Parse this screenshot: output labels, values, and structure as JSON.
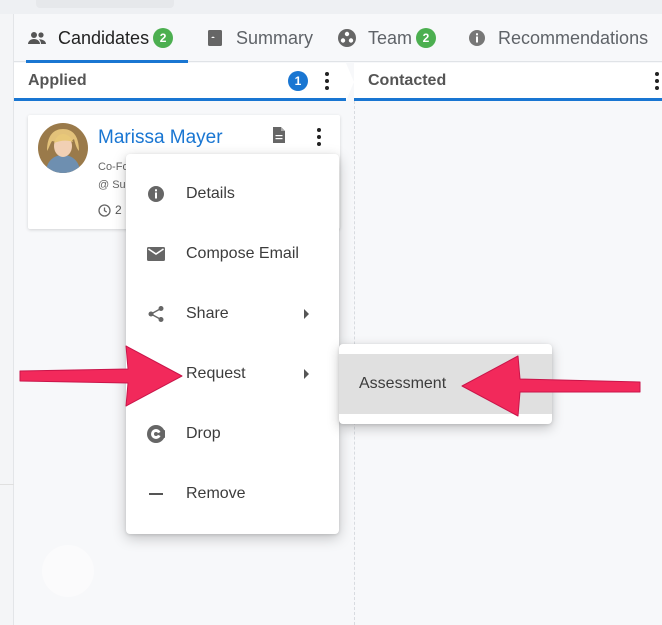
{
  "tabs": [
    {
      "label": "Candidates",
      "badge": "2",
      "icon": "people-icon",
      "active": true
    },
    {
      "label": "Summary",
      "icon": "book-icon"
    },
    {
      "label": "Team",
      "badge": "2",
      "icon": "team-icon"
    },
    {
      "label": "Recommendations",
      "icon": "info-icon"
    }
  ],
  "columns": {
    "applied": {
      "title": "Applied",
      "count": "1"
    },
    "contacted": {
      "title": "Contacted"
    }
  },
  "candidate": {
    "name": "Marissa Mayer",
    "meta1": "Co-Fo",
    "meta2": "@ Su",
    "meta3": "2"
  },
  "menu": {
    "details": "Details",
    "compose": "Compose Email",
    "share": "Share",
    "request": "Request",
    "drop": "Drop",
    "remove": "Remove"
  },
  "submenu": {
    "assessment": "Assessment"
  },
  "colors": {
    "accent": "#1976d2",
    "badge_green": "#4caf50",
    "annotation_arrow": "#f2295b"
  }
}
